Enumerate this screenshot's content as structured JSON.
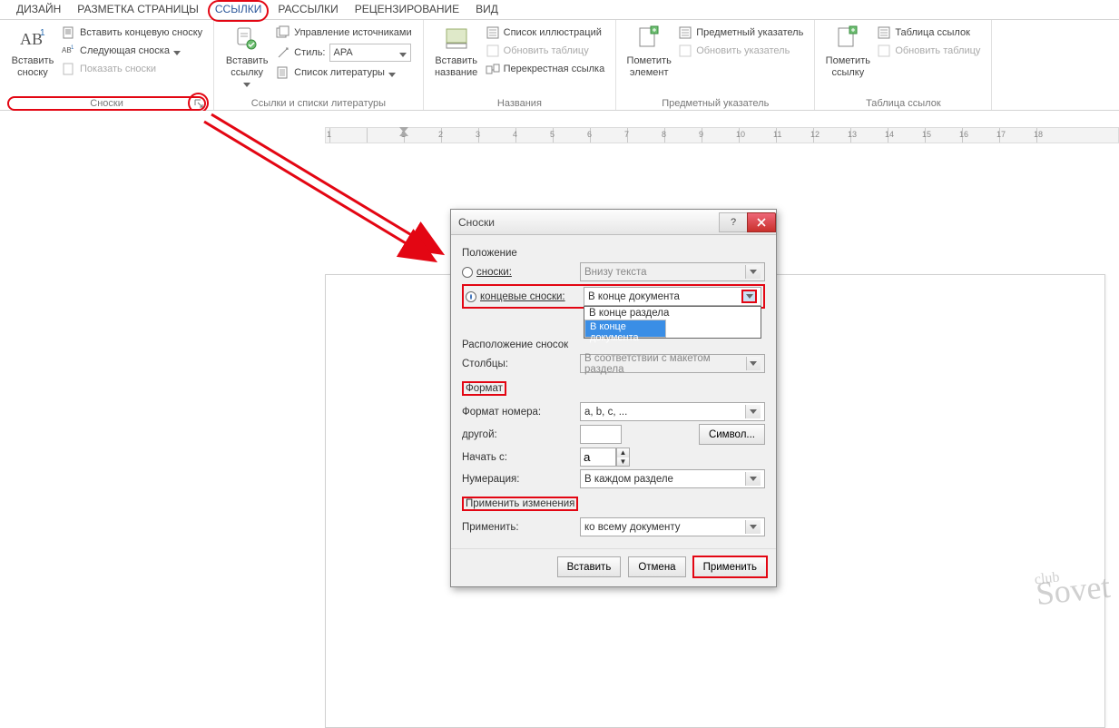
{
  "tabs": {
    "design": "ДИЗАЙН",
    "pagelayout": "РАЗМЕТКА СТРАНИЦЫ",
    "references": "ССЫЛКИ",
    "mailings": "РАССЫЛКИ",
    "review": "РЕЦЕНЗИРОВАНИЕ",
    "view": "ВИД"
  },
  "ribbon": {
    "footnote": {
      "insert": "Вставить\nсноску",
      "endnote": "Вставить концевую сноску",
      "next": "Следующая сноска",
      "show": "Показать сноски",
      "title": "Сноски"
    },
    "citation": {
      "insert": "Вставить\nссылку",
      "manage": "Управление источниками",
      "style_label": "Стиль:",
      "style_value": "APA",
      "bibliography": "Список литературы",
      "title": "Ссылки и списки литературы"
    },
    "caption": {
      "insert": "Вставить\nназвание",
      "figlist": "Список иллюстраций",
      "update": "Обновить таблицу",
      "crossref": "Перекрестная ссылка",
      "title": "Названия"
    },
    "index": {
      "mark": "Пометить\nэлемент",
      "subject": "Предметный указатель",
      "update": "Обновить указатель",
      "title": "Предметный указатель"
    },
    "toa": {
      "mark": "Пометить\nссылку",
      "table": "Таблица ссылок",
      "update": "Обновить таблицу",
      "title": "Таблица ссылок"
    }
  },
  "ruler_left": "2",
  "ruler_marks": [
    "1",
    "",
    "1",
    "2",
    "3",
    "4",
    "5",
    "6",
    "7",
    "8",
    "9",
    "10",
    "11",
    "12",
    "13",
    "14",
    "15",
    "16",
    "17",
    "18"
  ],
  "dialog": {
    "title": "Сноски",
    "section_position": "Положение",
    "footnotes_label": "сноски:",
    "footnotes_value": "Внизу текста",
    "endnotes_label": "концевые сноски:",
    "endnotes_value": "В конце документа",
    "endnotes_options": [
      "В конце раздела",
      "В конце документа"
    ],
    "section_layout": "Расположение сносок",
    "columns_label": "Столбцы:",
    "columns_value": "В соответствии с макетом раздела",
    "section_format": "Формат",
    "numfmt_label": "Формат номера:",
    "numfmt_value": "a, b, c, ...",
    "other_label": "другой:",
    "symbol_btn": "Символ...",
    "start_label": "Начать с:",
    "start_value": "a",
    "numbering_label": "Нумерация:",
    "numbering_value": "В каждом разделе",
    "section_apply": "Применить изменения",
    "applyto_label": "Применить:",
    "applyto_value": "ко всему документу",
    "btn_insert": "Вставить",
    "btn_cancel": "Отмена",
    "btn_apply": "Применить"
  },
  "watermark_top": "club",
  "watermark_main": "Sovet"
}
